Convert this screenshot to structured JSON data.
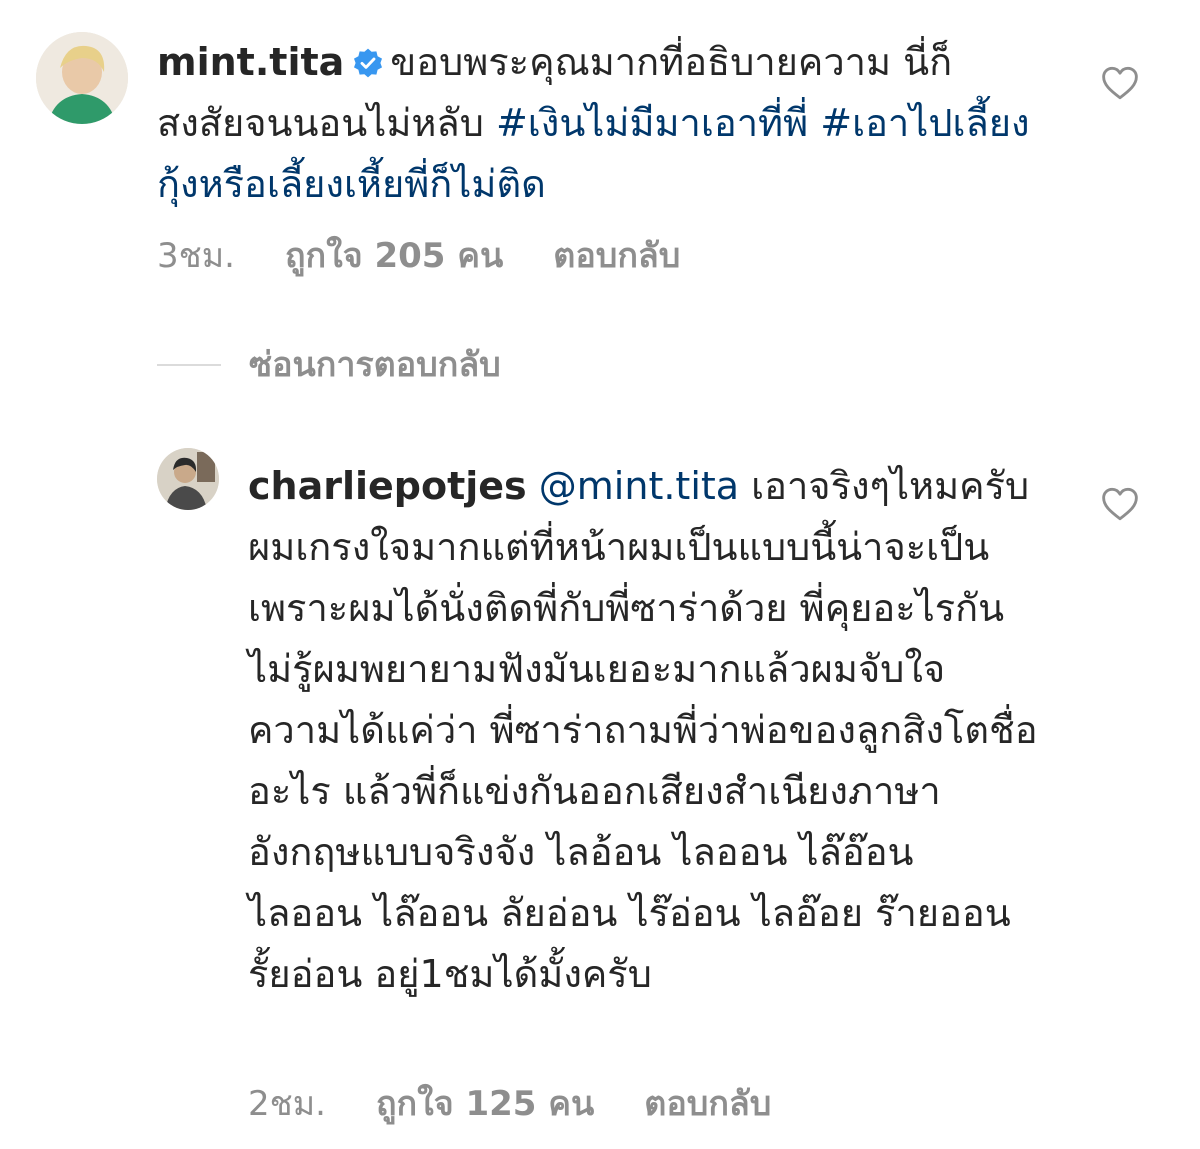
{
  "comments": [
    {
      "username": "mint.tita",
      "verified": true,
      "avatar_icon": "user-avatar",
      "text": "ขอบพระคุณมากที่อธิบายความ นี่ก็สงสัยจนนอนไม่หลับ",
      "hashtag_1": "#เงินไม่มีมาเอาที่พี่",
      "hashtag_2": "#เอาไปเลี้ยงกุ้งหรือเลี้ยงเหี้ยพี่ก็ไม่ติด",
      "time": "3ชม.",
      "likes": "ถูกใจ 205 คน",
      "reply_label": "ตอบกลับ"
    }
  ],
  "hide_replies_label": "ซ่อนการตอบกลับ",
  "replies": [
    {
      "username": "charliepotjes",
      "avatar_icon": "user-avatar",
      "mention": "@mint.tita",
      "text": "เอาจริงๆไหมครับผมเกรงใจมากแต่ที่หน้าผมเป็นแบบนี้น่าจะเป็นเพราะผมได้นั่งติดพี่กับพี่ซาร่าด้วย พี่คุยอะไรกันไม่รู้ผมพยายามฟังมันเยอะมากแล้วผมจับใจความได้แค่ว่า พี่ซาร่าถามพี่ว่าพ่อของลูกสิงโตชื่ออะไร แล้วพี่ก็แข่งกันออกเสียงสำเนียงภาษาอังกฤษแบบจริงจัง ไลอ้อน ไลออน ไล๊อ๊อน ไลออน ไล๊ออน ลัยอ่อน ไร๊อ่อน ไลอ๊อย ร๊ายออน รั้ยอ่อน อยู่1ชมได้มั้งครับ",
      "time": "2ชม.",
      "likes": "ถูกใจ 125 คน",
      "reply_label": "ตอบกลับ"
    }
  ],
  "colors": {
    "text": "#262626",
    "link": "#00376b",
    "meta": "#8e8e8e",
    "verified": "#3897f0"
  },
  "icons": {
    "like": "heart-outline-icon",
    "verified": "verified-badge-icon"
  }
}
